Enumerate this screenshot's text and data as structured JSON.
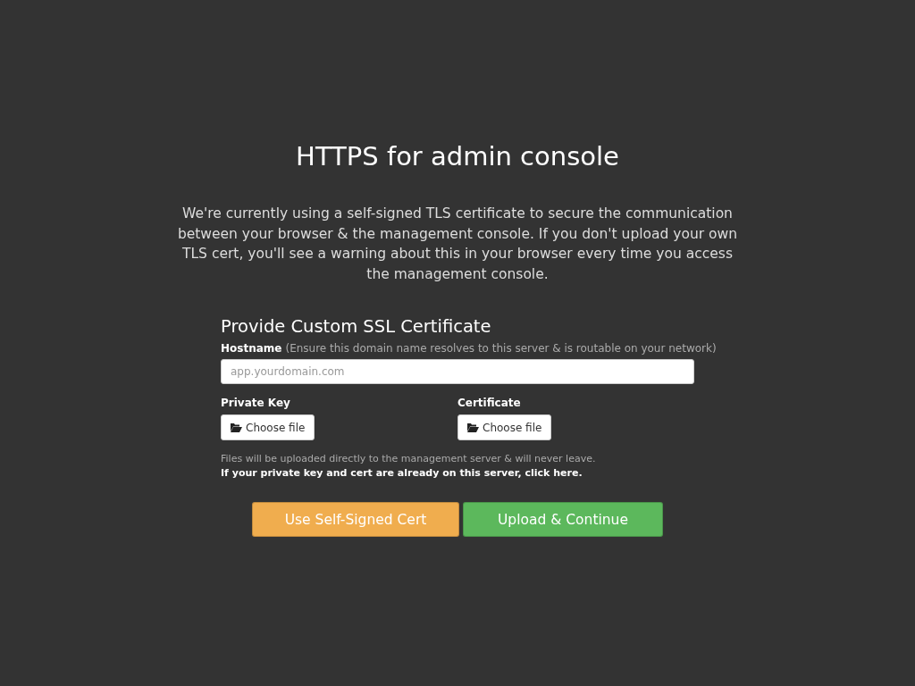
{
  "title": "HTTPS for admin console",
  "intro": "We're currently using a self-signed TLS certificate to secure the communication between your browser & the management console. If you don't upload your own TLS cert, you'll see a warning about this in your browser every time you access the management console.",
  "form": {
    "heading": "Provide Custom SSL Certificate",
    "hostname_label": "Hostname",
    "hostname_hint": "(Ensure this domain name resolves to this server & is routable on your network)",
    "hostname_placeholder": "app.yourdomain.com",
    "files": [
      {
        "label": "Private Key",
        "button": "Choose file"
      },
      {
        "label": "Certificate",
        "button": "Choose file"
      }
    ],
    "note": "Files will be uploaded directly to the management server & will never leave.",
    "link": "If your private key and cert are already on this server, click here."
  },
  "buttons": [
    {
      "label": "Use Self-Signed Cert",
      "kind": "warning"
    },
    {
      "label": "Upload & Continue",
      "kind": "success"
    }
  ]
}
